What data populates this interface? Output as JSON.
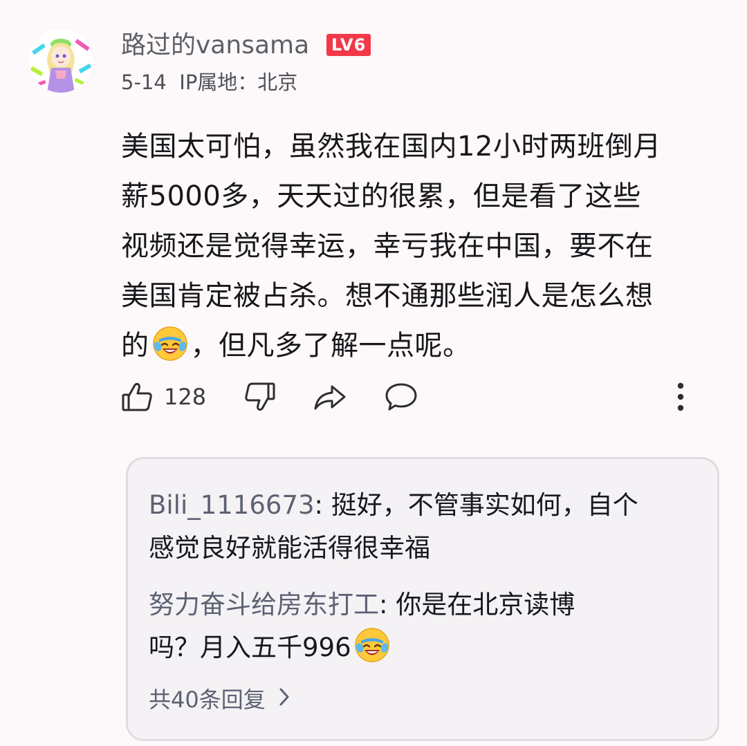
{
  "comment": {
    "username": "路过的vansama",
    "level_badge": "LV6",
    "date": "5-14",
    "ip_location": "IP属地：北京",
    "text_lines": [
      "美国太可怕，虽然我在国内12小时两班倒月",
      "薪5000多，天天过的很累，但是看了这些",
      "视频还是觉得幸运，幸亏我在中国，要不在",
      "美国肯定被占杀。想不通那些润人是怎么想"
    ],
    "last_line_before_emoji": "的",
    "last_line_after_emoji": "，但凡多了解一点呢。",
    "emoji": "laugh-cry-emoji",
    "like_count": "128"
  },
  "replies": [
    {
      "user": "Bili_1116673",
      "text_line1": ": 挺好，不管事实如何，自个",
      "text_line2": "感觉良好就能活得很幸福"
    },
    {
      "user": "努力奋斗给房东打工",
      "text_line1": ": 你是在北京读博",
      "text_line2": "吗？月入五千996",
      "emoji": "laugh-cry-emoji"
    }
  ],
  "reply_count_label": "共40条回复",
  "colors": {
    "background": "#fdf8fa",
    "level_badge": "#f2394a",
    "reply_username": "#5c6273",
    "reply_box": "#f4f2f4"
  },
  "icons": [
    "thumbs-up-icon",
    "thumbs-down-icon",
    "share-icon",
    "comment-icon",
    "more-vertical-icon",
    "chevron-right-icon"
  ]
}
